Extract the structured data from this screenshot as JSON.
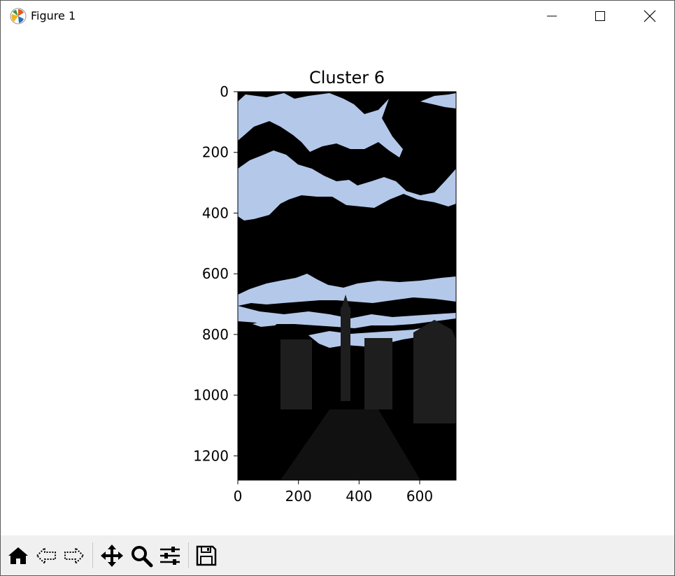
{
  "window": {
    "title": "Figure 1"
  },
  "toolbar": {
    "buttons": [
      "home-icon",
      "back-arrow-icon",
      "forward-arrow-icon",
      "pan-move-icon",
      "zoom-magnifier-icon",
      "configure-subplots-icon",
      "save-disk-icon"
    ]
  },
  "chart_data": {
    "type": "image",
    "title": "Cluster 6",
    "xlabel": "",
    "ylabel": "",
    "xlim": [
      0,
      720
    ],
    "ylim": [
      1280,
      0
    ],
    "x_ticks": [
      0,
      200,
      400,
      600
    ],
    "y_ticks": [
      0,
      200,
      400,
      600,
      800,
      1000,
      1200
    ],
    "grid": false,
    "image_colors": {
      "sky": "#b4c8ea",
      "background": "#000000"
    }
  }
}
